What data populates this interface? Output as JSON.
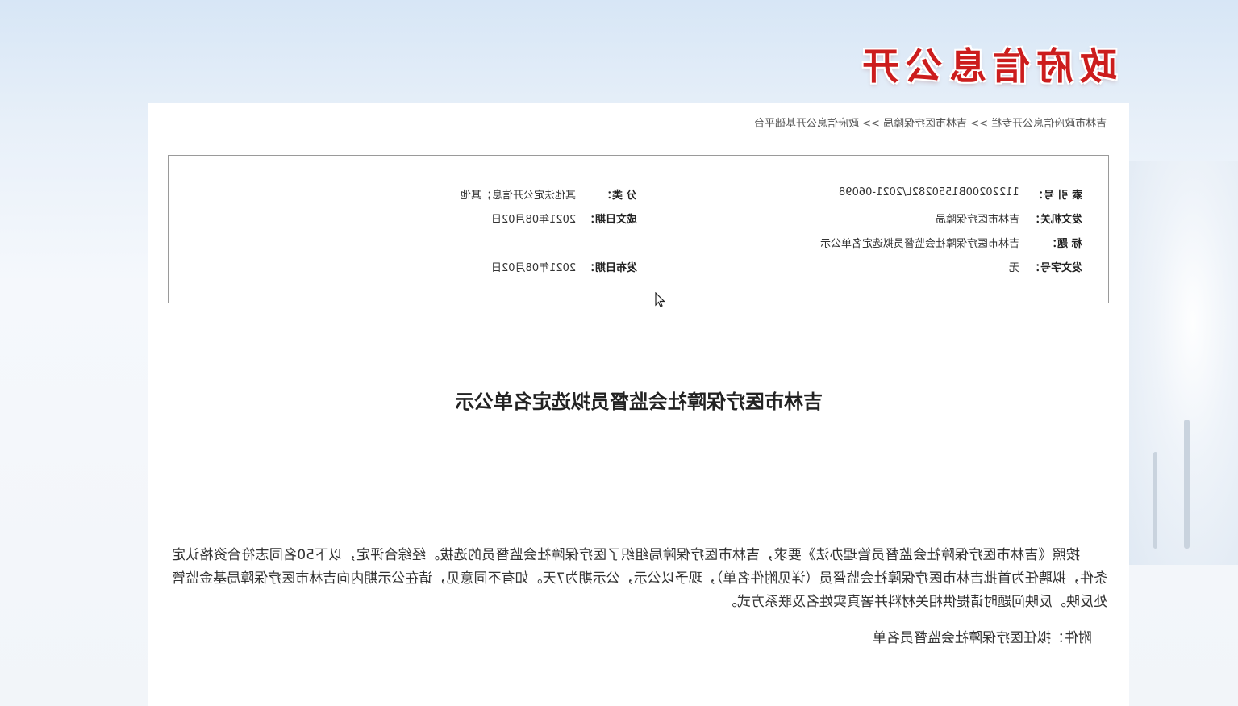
{
  "header": {
    "site_title": "政府信息公开"
  },
  "breadcrumb": {
    "text": "吉林市政府信息公开专栏 >> 吉林市医疗保障局 >> 政府信息公开基础平台"
  },
  "meta": {
    "index_label": "索 引 号：",
    "index_value": "11220200B1550282L/2021-06098",
    "category_label": "分    类：",
    "category_value": "其他法定公开信息；其他",
    "issuer_label": "发文机关：",
    "issuer_value": "吉林市医疗保障局",
    "written_date_label": "成文日期：",
    "written_date_value": "2021年08月02日",
    "title_label": "标    题：",
    "title_value": "吉林市医疗保障社会监督员拟选定名单公示",
    "doc_number_label": "发文字号：",
    "doc_number_value": "无",
    "publish_date_label": "发布日期：",
    "publish_date_value": "2021年08月02日"
  },
  "document": {
    "title": "吉林市医疗保障社会监督员拟选定名单公示",
    "body": "按照《吉林市医疗保障社会监督员管理办法》要求，吉林市医疗保障局组织了医疗保障社会监督员的选拔。经综合评定，以下50名同志符合资格认定条件，拟聘任为首批吉林市医疗保障社会监督员（详见附件名单），现予以公示，公示期为7天。如有不同意见，请在公示期内向吉林市医疗保障局基金监管处反映。反映问题时请提供相关材料并署真实姓名及联系方式。",
    "attachment": "附件：拟任医疗保障社会监督员名单"
  },
  "colors": {
    "header_red": "#cc1d1d",
    "panel_bg": "#ffffff",
    "border": "#9a9a9a"
  },
  "icons": {
    "cursor": "mouse-pointer-icon"
  }
}
